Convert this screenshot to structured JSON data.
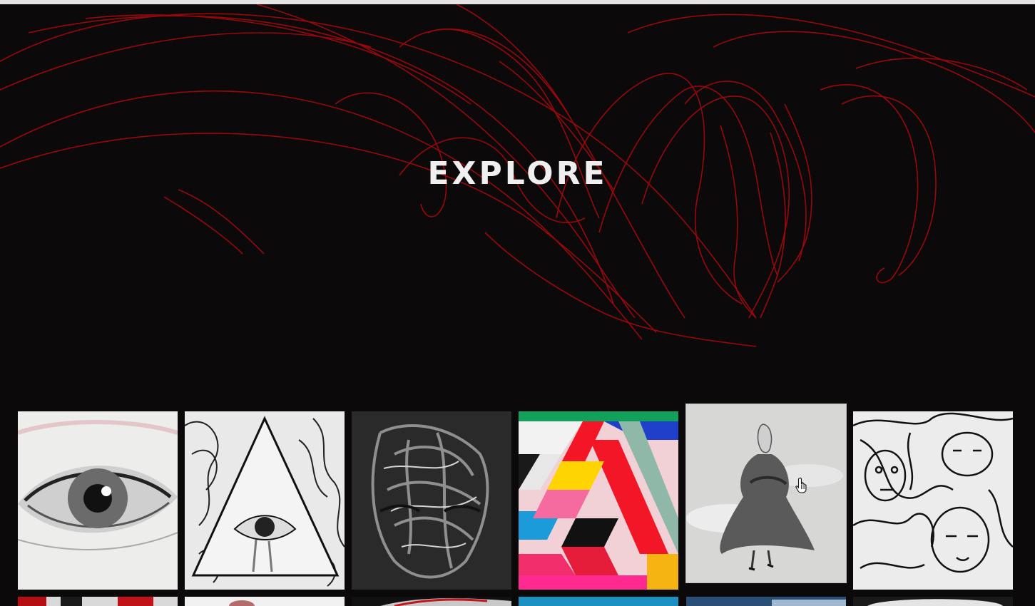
{
  "hero": {
    "title": "EXPLORE",
    "background_color": "#0b090a",
    "scribble_color": "#b0090c"
  },
  "gallery": {
    "row1": [
      {
        "name": "eye-sketch-artwork"
      },
      {
        "name": "triangle-eye-artwork"
      },
      {
        "name": "tangled-face-artwork"
      },
      {
        "name": "geometric-color-artwork"
      },
      {
        "name": "woman-in-coat-artwork"
      },
      {
        "name": "line-faces-artwork"
      }
    ],
    "row2_count": 6
  },
  "cursor": {
    "icon": "hand-pointer-icon"
  }
}
